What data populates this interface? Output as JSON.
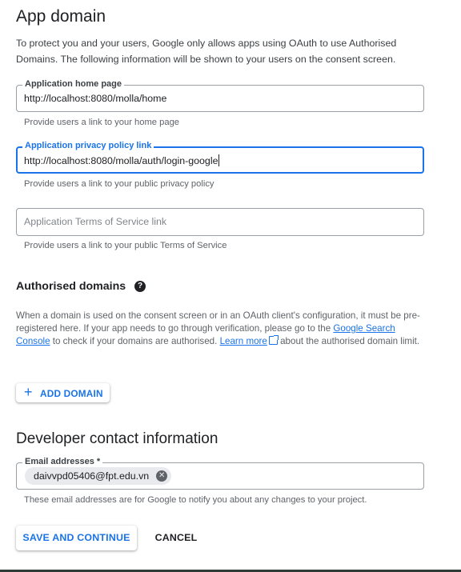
{
  "app_domain": {
    "title": "App domain",
    "description": "To protect you and your users, Google only allows apps using OAuth to use Authorised Domains. The following information will be shown to your users on the consent screen."
  },
  "home_page": {
    "label": "Application home page",
    "value": "http://localhost:8080/molla/home",
    "hint": "Provide users a link to your home page"
  },
  "privacy_policy": {
    "label": "Application privacy policy link",
    "value": "http://localhost:8080/molla/auth/login-google",
    "hint": "Provide users a link to your public privacy policy"
  },
  "terms": {
    "placeholder": "Application Terms of Service link",
    "hint": "Provide users a link to your public Terms of Service"
  },
  "authorised_domains": {
    "title": "Authorised domains",
    "desc_part1": "When a domain is used on the consent screen or in an OAuth client's configuration, it must be pre-registered here. If your app needs to go through verification, please go to the ",
    "link_search_console": "Google Search Console",
    "desc_part2": " to check if your domains are authorised. ",
    "link_learn_more": "Learn more",
    "desc_part3": " about the authorised domain limit.",
    "add_button": "ADD DOMAIN"
  },
  "developer_contact": {
    "title": "Developer contact information",
    "label": "Email addresses *",
    "chip": "daivvpd05406@fpt.edu.vn",
    "hint": "These email addresses are for Google to notify you about any changes to your project."
  },
  "actions": {
    "save": "SAVE AND CONTINUE",
    "cancel": "CANCEL"
  },
  "colors": {
    "accent": "#1a73e8",
    "text": "#202124",
    "secondary_text": "#5f6368"
  }
}
